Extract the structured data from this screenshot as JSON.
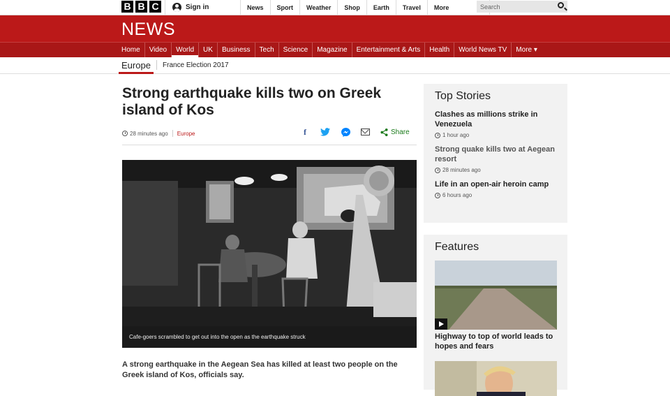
{
  "topbar": {
    "logo_letters": [
      "B",
      "B",
      "C"
    ],
    "signin_label": "Sign in",
    "nav": [
      "News",
      "Sport",
      "Weather",
      "Shop",
      "Earth",
      "Travel"
    ],
    "more_label": "More",
    "search_placeholder": "Search"
  },
  "banner": {
    "title": "NEWS",
    "color": "#bb1919"
  },
  "mainnav": {
    "items": [
      "Home",
      "Video",
      "World",
      "UK",
      "Business",
      "Tech",
      "Science",
      "Magazine",
      "Entertainment & Arts",
      "Health",
      "World News TV",
      "More ▾"
    ],
    "active": "World"
  },
  "subnav": {
    "section": "Europe",
    "link": "France Election 2017"
  },
  "article": {
    "headline": "Strong earthquake kills two on Greek island of Kos",
    "time": "28 minutes ago",
    "section": "Europe",
    "share_label": "Share",
    "share_icons": [
      "facebook-icon",
      "twitter-icon",
      "messenger-icon",
      "email-icon",
      "share-icon"
    ],
    "caption": "Cafe-goers scrambled to get out into the open as the earthquake struck",
    "lede": "A strong earthquake in the Aegean Sea has killed at least two people on the Greek island of Kos, officials say."
  },
  "top_stories": {
    "heading": "Top Stories",
    "items": [
      {
        "title": "Clashes as millions strike in Venezuela",
        "time": "1 hour ago"
      },
      {
        "title": "Strong quake kills two at Aegean resort",
        "time": "28 minutes ago"
      },
      {
        "title": "Life in an open-air heroin camp",
        "time": "6 hours ago"
      }
    ]
  },
  "features": {
    "heading": "Features",
    "items": [
      {
        "title": "Highway to top of world leads to hopes and fears"
      }
    ]
  }
}
